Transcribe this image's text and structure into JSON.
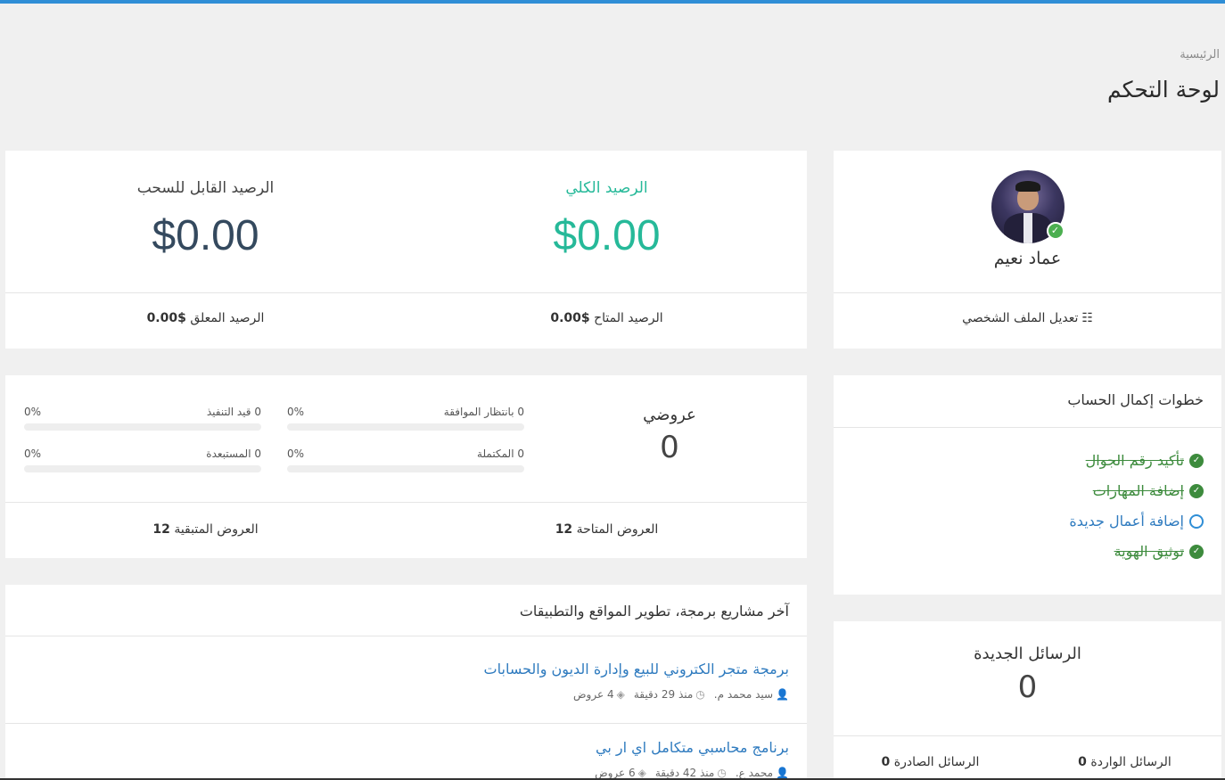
{
  "breadcrumb": "الرئيسية",
  "page_title": "لوحة التحكم",
  "profile": {
    "name": "عماد نعيم",
    "edit_label": "تعديل الملف الشخصي",
    "edit_icon": "sliders-icon",
    "verified_icon": "check-circle-icon"
  },
  "balance": {
    "total_label": "الرصيد الكلي",
    "total_value": "$0.00",
    "withdrawable_label": "الرصيد القابل للسحب",
    "withdrawable_value": "$0.00",
    "available_label": "الرصيد المتاح",
    "available_value": "$0.00",
    "pending_label": "الرصيد المعلق",
    "pending_value": "$0.00"
  },
  "steps": {
    "heading": "خطوات إكمال الحساب",
    "items": [
      {
        "label": "تأكيد رقم الجوال",
        "done": true
      },
      {
        "label": "إضافة المهارات",
        "done": true
      },
      {
        "label": "إضافة أعمال جديدة",
        "done": false
      },
      {
        "label": "توثيق الهوية",
        "done": true
      }
    ]
  },
  "messages": {
    "title": "الرسائل الجديدة",
    "count": "0",
    "inbox_label": "الرسائل الواردة",
    "inbox_value": "0",
    "outbox_label": "الرسائل الصادرة",
    "outbox_value": "0"
  },
  "offers": {
    "title": "عروضي",
    "count": "0",
    "progress": [
      {
        "label": "0 بانتظار الموافقة",
        "percent_text": "0%",
        "fraction": 0
      },
      {
        "label": "0 قيد التنفيذ",
        "percent_text": "0%",
        "fraction": 0
      },
      {
        "label": "0 المكتملة",
        "percent_text": "0%",
        "fraction": 0
      },
      {
        "label": "0 المستبعدة",
        "percent_text": "0%",
        "fraction": 0
      }
    ],
    "available_label": "العروض المتاحة",
    "available_value": "12",
    "remaining_label": "العروض المتبقية",
    "remaining_value": "12"
  },
  "projects": {
    "heading": "آخر مشاريع برمجة، تطوير المواقع والتطبيقات",
    "items": [
      {
        "title": "برمجة متجر الكتروني للبيع وإدارة الديون والحسابات",
        "author": "سيد محمد م.",
        "time": "منذ 29 دقيقة",
        "offers": "4 عروض"
      },
      {
        "title": "برنامج محاسبي متكامل اي ار بي",
        "author": "محمد ع.",
        "time": "منذ 42 دقيقة",
        "offers": "6 عروض"
      }
    ]
  },
  "colors": {
    "accent": "#2f8ed6",
    "success": "#26b999",
    "done_green": "#3d8b3d"
  }
}
